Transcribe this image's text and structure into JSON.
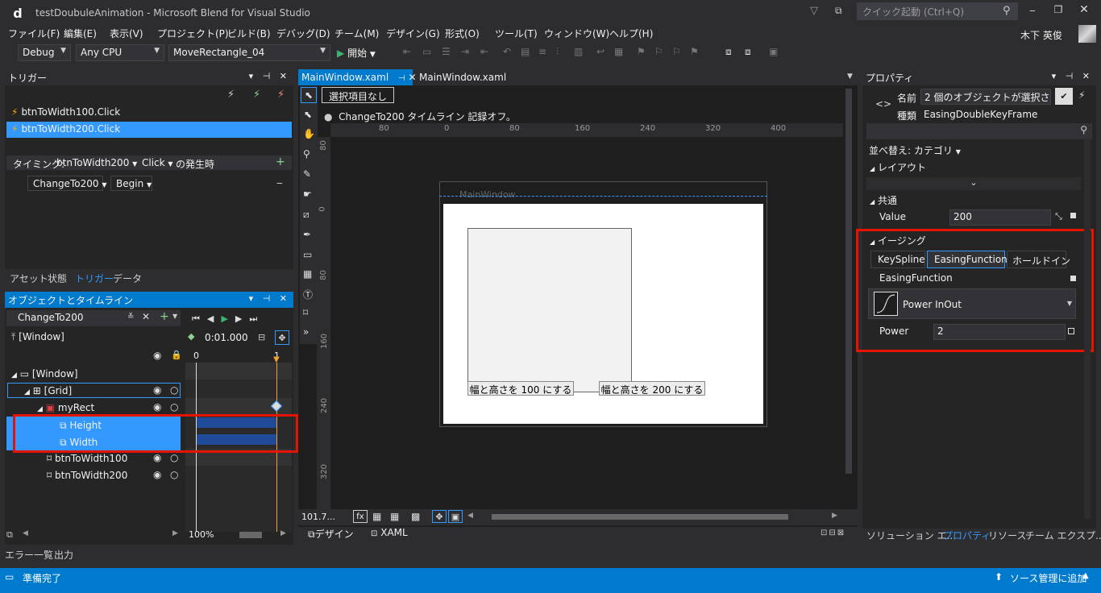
{
  "window": {
    "title": "testDoubuleAnimation - Microsoft Blend for Visual Studio",
    "logo": "d",
    "quick_launch_placeholder": "クイック起動 (Ctrl+Q)",
    "user": "木下 英俊"
  },
  "menu": [
    "ファイル(F)",
    "編集(E)",
    "表示(V)",
    "プロジェクト(P)",
    "ビルド(B)",
    "デバッグ(D)",
    "チーム(M)",
    "デザイン(G)",
    "形式(O)",
    "ツール(T)",
    "ウィンドウ(W)",
    "ヘルプ(H)"
  ],
  "toolbar": {
    "config": "Debug",
    "platform": "Any CPU",
    "startup": "MoveRectangle_04",
    "start_label": "開始"
  },
  "triggers": {
    "title": "トリガー",
    "items": [
      "btnToWidth100.Click",
      "btnToWidth200.Click"
    ],
    "timing_label": "タイミング:",
    "timing_source": "btnToWidth200",
    "timing_event": "Click",
    "timing_suffix": "の発生時",
    "action_story": "ChangeTo200",
    "action_verb": "Begin"
  },
  "left_tabs": [
    "アセット",
    "状態",
    "トリガー",
    "データ"
  ],
  "objects": {
    "title": "オブジェクトとタイムライン",
    "storyboard": "ChangeTo200",
    "scope": "[Window]",
    "time": "0:01.000",
    "ruler0": "0",
    "ruler1": "1",
    "zoom": "100%",
    "tree": [
      "[Window]",
      "[Grid]",
      "myRect",
      "Height",
      "Width",
      "btnToWidth100",
      "btnToWidth200"
    ]
  },
  "doc_tabs": [
    "MainWindow.xaml",
    "MainWindow.xaml"
  ],
  "design": {
    "selection": "選択項目なし",
    "recording": "ChangeTo200 タイムライン 記録オフ。",
    "hruler": [
      "80",
      "0",
      "80",
      "160",
      "240",
      "320",
      "400"
    ],
    "vruler": [
      "80",
      "0",
      "80",
      "160",
      "240",
      "320"
    ],
    "window_title": "MainWindow",
    "btn100": "幅と高さを 100 にする",
    "btn200": "幅と高さを 200 にする",
    "zoom": "101.7...",
    "design_tab": "デザイン",
    "xaml_tab": "XAML"
  },
  "properties": {
    "title": "プロパティ",
    "name_label": "名前",
    "name_value": "2 個のオブジェクトが選択されて...",
    "type_label": "種類",
    "type_value": "EasingDoubleKeyFrame",
    "sort": "並べ替え: カテゴリ",
    "layout": "レイアウト",
    "common": "共通",
    "value_label": "Value",
    "value": "200",
    "easing": "イージング",
    "easing_tabs": [
      "KeySpline",
      "EasingFunction",
      "ホールドイン"
    ],
    "easing_fn_label": "EasingFunction",
    "easing_fn_value": "Power InOut",
    "power_label": "Power",
    "power_value": "2"
  },
  "right_tabs": [
    "ソリューション エ...",
    "プロパティ",
    "リソース",
    "チーム エクスプ..."
  ],
  "bottom_tabs": [
    "エラー一覧",
    "出力"
  ],
  "status": {
    "ready": "準備完了",
    "scm": "ソース管理に追加"
  },
  "colors": {
    "accent": "#007acc",
    "selection": "#3399ff",
    "highlight": "#e51400"
  }
}
